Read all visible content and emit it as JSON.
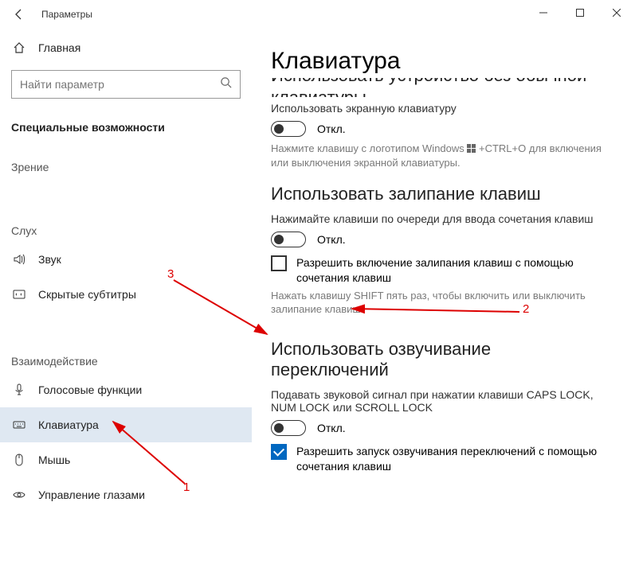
{
  "window": {
    "title": "Параметры"
  },
  "sidebar": {
    "home": "Главная",
    "search_placeholder": "Найти параметр",
    "group_accessibility": "Специальные возможности",
    "cat_vision": "Зрение",
    "cat_hearing": "Слух",
    "cat_interaction": "Взаимодействие",
    "items": {
      "audio": "Звук",
      "captions": "Скрытые субтитры",
      "speech": "Голосовые функции",
      "keyboard": "Клавиатура",
      "mouse": "Мышь",
      "eye": "Управление глазами"
    }
  },
  "page": {
    "title": "Клавиатура",
    "sec1_head_cut": "Использовать устройство без обычной клавиатуры",
    "sec1_body": "Использовать экранную клавиатуру",
    "off": "Откл.",
    "sec1_hint_a": "Нажмите клавишу с логотипом Windows ",
    "sec1_hint_b": " +CTRL+O для включения или выключения экранной клавиатуры.",
    "sec2_head": "Использовать залипание клавиш",
    "sec2_body": "Нажимайте клавиши по очереди для ввода сочетания клавиш",
    "sec2_check": "Разрешить включение залипания клавиш с помощью сочетания клавиш",
    "sec2_hint": "Нажать клавишу SHIFT пять раз, чтобы включить или выключить залипание клавиш",
    "sec3_head": "Использовать озвучивание переключений",
    "sec3_body": "Подавать звуковой сигнал при нажатии клавиши CAPS LOCK, NUM LOCK или SCROLL LOCK",
    "sec3_check": "Разрешить запуск озвучивания переключений с помощью сочетания клавиш"
  },
  "annotations": {
    "n1": "1",
    "n2": "2",
    "n3": "3"
  }
}
